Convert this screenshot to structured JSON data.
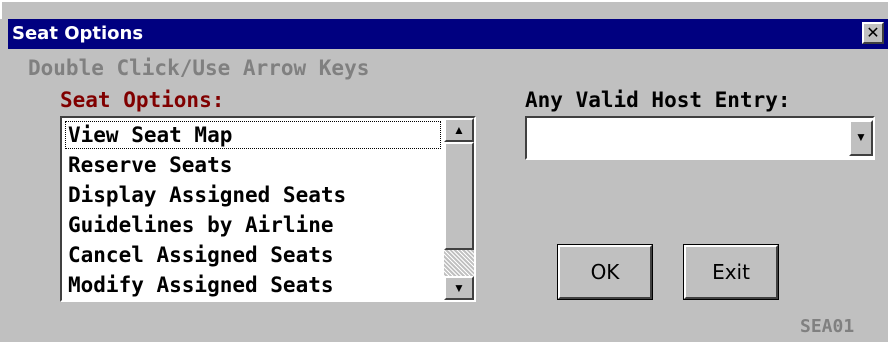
{
  "window": {
    "title": "Seat Options",
    "close_glyph": "✕"
  },
  "hint_text": "Double Click/Use Arrow Keys",
  "options": {
    "label": "Seat Options:",
    "items": [
      "View Seat Map",
      "Reserve Seats",
      "Display Assigned Seats",
      "Guidelines by Airline",
      "Cancel Assigned Seats",
      "Modify Assigned Seats"
    ],
    "selected_index": 0,
    "scroll_up_glyph": "▲",
    "scroll_down_glyph": "▼"
  },
  "host_entry": {
    "label": "Any Valid Host Entry:",
    "value": "",
    "dropdown_glyph": "▼"
  },
  "buttons": {
    "ok_label": "OK",
    "exit_label": "Exit"
  },
  "screen_code": "SEA01",
  "colors": {
    "titlebar": "#000080",
    "options_label": "#800000",
    "hint": "#808080",
    "face": "#c0c0c0"
  }
}
